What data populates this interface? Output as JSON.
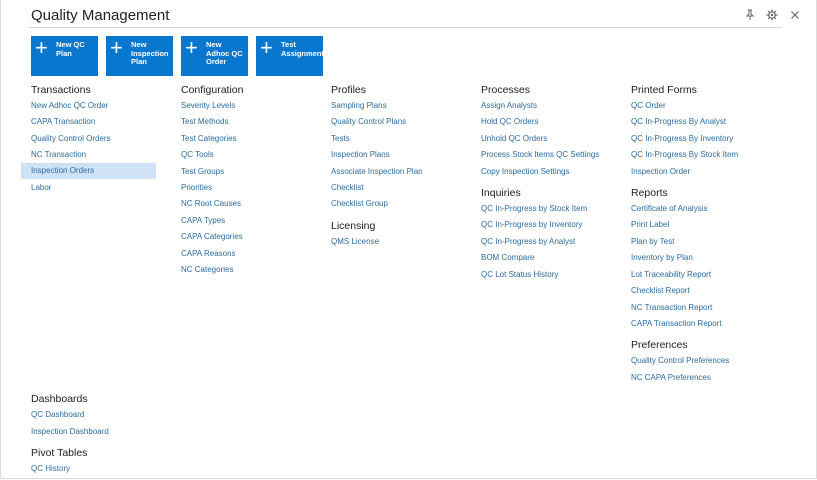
{
  "header": {
    "title": "Quality Management",
    "icons": [
      "pin-icon",
      "gear-icon",
      "close-icon"
    ]
  },
  "tiles": [
    {
      "label": "New QC\nPlan"
    },
    {
      "label": "New\nInspection\nPlan"
    },
    {
      "label": "New\nAdhoc QC\nOrder"
    },
    {
      "label": "Test\nAssignment"
    }
  ],
  "transactions": {
    "title": "Transactions",
    "items": [
      "New Adhoc QC Order",
      "CAPA Transaction",
      "Quality Control Orders",
      "NC Transaction",
      "Inspection Orders",
      "Labor"
    ],
    "selected": "Inspection Orders"
  },
  "configuration": {
    "title": "Configuration",
    "items": [
      "Severity Levels",
      "Test Methods",
      "Test Categories",
      "QC Tools",
      "Test Groups",
      "Priorities",
      "NC Root Causes",
      "CAPA Types",
      "CAPA Categories",
      "CAPA Reasons",
      "NC Categories"
    ]
  },
  "profiles": {
    "title": "Profiles",
    "items": [
      "Sampling Plans",
      "Quality Control Plans",
      "Tests",
      "Inspection Plans",
      "Associate Inspection Plan",
      "Checklist",
      "Checklist Group"
    ]
  },
  "licensing": {
    "title": "Licensing",
    "items": [
      "QMS License"
    ]
  },
  "processes": {
    "title": "Processes",
    "items": [
      "Assign Analysts",
      "Hold QC Orders",
      "Unhold QC Orders",
      "Process Stock Items QC Settings",
      "Copy Inspection Settings"
    ]
  },
  "inquiries": {
    "title": "Inquiries",
    "items": [
      "QC In-Progress by Stock Item",
      "QC In-Progress by Inventory",
      "QC In-Progress by Analyst",
      "BOM Compare",
      "QC Lot Status History"
    ]
  },
  "printed_forms": {
    "title": "Printed Forms",
    "items": [
      "QC Order",
      "QC In-Progress By Analyst",
      "QC In-Progress By Inventory",
      "QC In-Progress By Stock Item",
      "Inspection Order"
    ]
  },
  "reports": {
    "title": "Reports",
    "items": [
      "Certificate of Analysis",
      "Print Label",
      "Plan by Test",
      "Inventory by Plan",
      "Lot Traceability Report",
      "Checklist Report",
      "NC Transaction Report",
      "CAPA Transaction Report"
    ]
  },
  "preferences": {
    "title": "Preferences",
    "items": [
      "Quality Control Preferences",
      "NC CAPA Preferences"
    ]
  },
  "dashboards": {
    "title": "Dashboards",
    "items": [
      "QC Dashboard",
      "Inspection Dashboard"
    ]
  },
  "pivot_tables": {
    "title": "Pivot Tables",
    "items": [
      "QC History"
    ]
  }
}
